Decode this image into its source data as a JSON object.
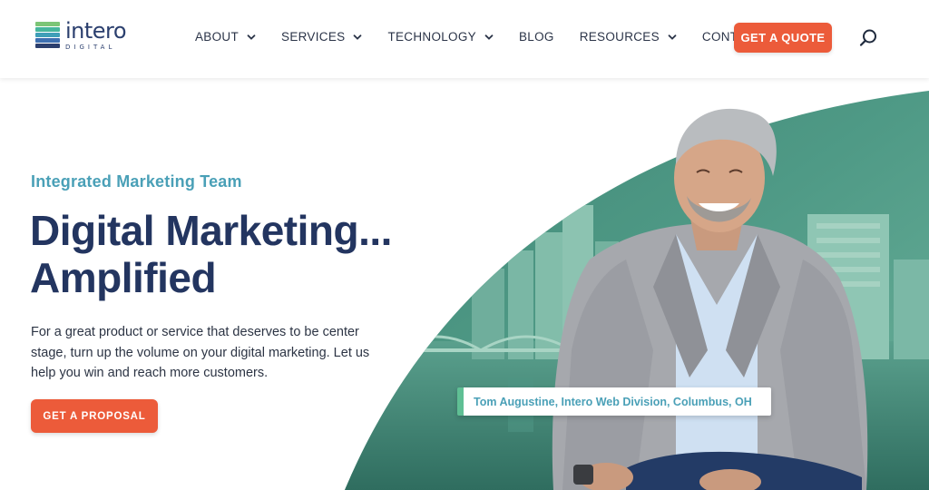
{
  "brand": {
    "name": "intero",
    "sub": "DIGITAL",
    "colors": {
      "navy": "#2b3f6e",
      "teal": "#4aa0b7",
      "orange": "#ec5b3a",
      "green": "#5fbf94"
    },
    "stripe_colors": [
      "#7cc576",
      "#46b69c",
      "#3f9fb8",
      "#3d6fb0",
      "#2b3f6e"
    ]
  },
  "nav": {
    "items": [
      {
        "label": "ABOUT",
        "has_dropdown": true
      },
      {
        "label": "SERVICES",
        "has_dropdown": true
      },
      {
        "label": "TECHNOLOGY",
        "has_dropdown": true
      },
      {
        "label": "BLOG",
        "has_dropdown": false
      },
      {
        "label": "RESOURCES",
        "has_dropdown": true
      },
      {
        "label": "CONTACT US",
        "has_dropdown": false
      }
    ],
    "cta_label": "GET A QUOTE",
    "search_icon": "search-icon"
  },
  "hero": {
    "eyebrow": "Integrated Marketing Team",
    "headline_line1": "Digital Marketing...",
    "headline_line2": "Amplified",
    "body": "For a great product or service that deserves to be center stage, turn up the volume on your digital marketing. Let us help you win and reach more customers.",
    "cta_label": "GET A PROPOSAL",
    "caption": "Tom Augustine, Intero Web Division, Columbus, OH"
  }
}
